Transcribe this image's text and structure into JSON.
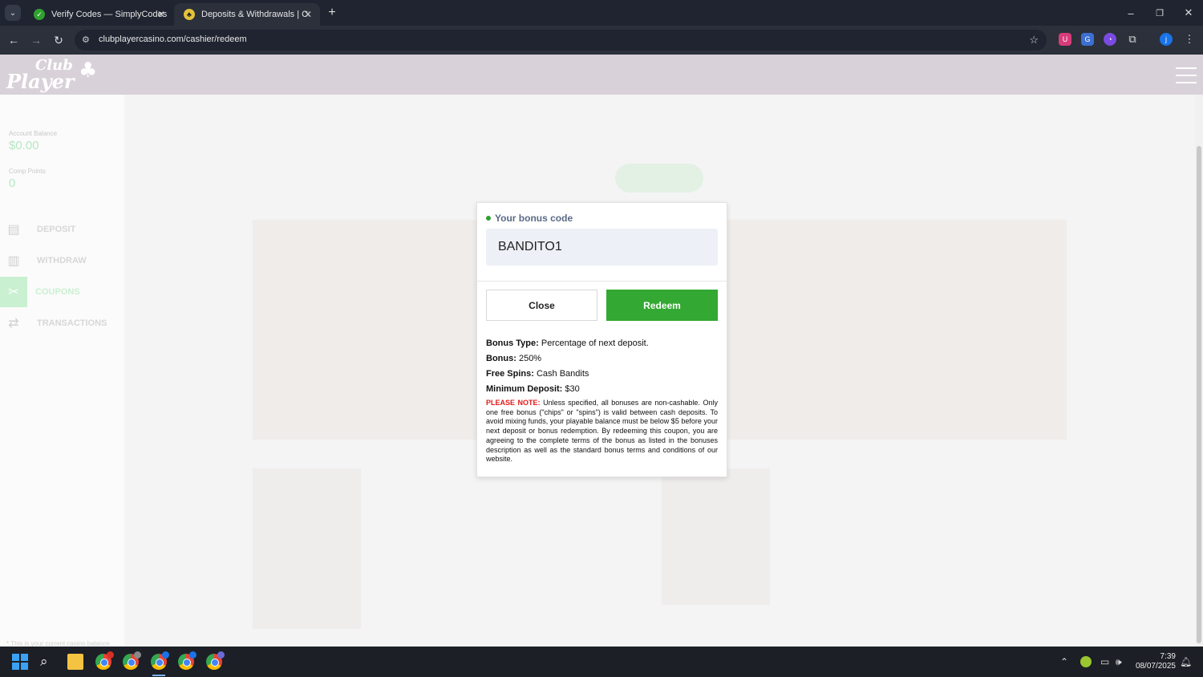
{
  "browser": {
    "tabs": [
      {
        "title": "Verify Codes — SimplyCodes",
        "active": false
      },
      {
        "title": "Deposits & Withdrawals | Club",
        "active": true
      }
    ],
    "new_tab_label": "+",
    "url": "clubplayercasino.com/cashier/redeem"
  },
  "site": {
    "logo_text_1": "Club",
    "logo_text_2": "Player"
  },
  "sidebar": {
    "balance_label": "Account Balance",
    "balance_value": "$0.00",
    "comp_label": "Comp Points",
    "comp_value": "0",
    "items": [
      {
        "label": "DEPOSIT"
      },
      {
        "label": "WITHDRAW"
      },
      {
        "label": "COUPONS"
      },
      {
        "label": "TRANSACTIONS"
      }
    ],
    "note": "* This is your current casino balance though the approved withdrawal amount may differ due to max cash out limits and/or removal of casino bonus cash."
  },
  "modal": {
    "code_label": "Your bonus code",
    "code_value": "BANDITO1",
    "close_label": "Close",
    "redeem_label": "Redeem",
    "bonus_type_label": "Bonus Type:",
    "bonus_type_value": "Percentage of next deposit.",
    "bonus_label": "Bonus:",
    "bonus_value": "250%",
    "free_spins_label": "Free Spins:",
    "free_spins_value": "Cash Bandits",
    "min_deposit_label": "Minimum Deposit:",
    "min_deposit_value": "$30",
    "note_label": "PLEASE NOTE:",
    "note_text": "Unless specified, all bonuses are non-cashable. Only one free bonus (\"chips\" or \"spins\") is valid between cash deposits. To avoid mixing funds, your playable balance must be below $5 before your next deposit or bonus redemption. By redeeming this coupon, you are agreeing to the complete terms of the bonus as listed in the bonuses description as well as the standard bonus terms and conditions of our website."
  },
  "taskbar": {
    "time": "7:39",
    "date": "08/07/2025"
  },
  "colors": {
    "redeem_green": "#33a832",
    "note_red": "#e21b1b",
    "header_bg": "#d9d1d9"
  }
}
